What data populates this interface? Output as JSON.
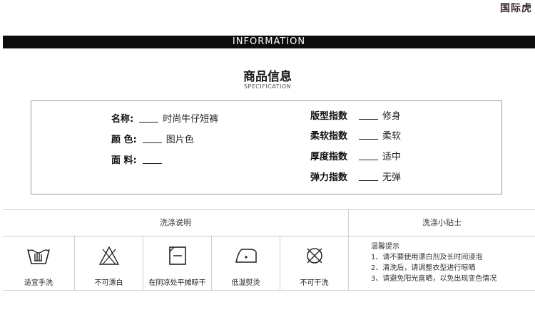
{
  "watermark": "国际虎",
  "banner": "INFORMATION",
  "spec": {
    "title": "商品信息",
    "subtitle": "SPECIFICATION",
    "left": [
      {
        "label": "名称:",
        "value": "时尚牛仔短裤"
      },
      {
        "label": "颜 色:",
        "value": "图片色"
      },
      {
        "label": "面 料:",
        "value": ""
      }
    ],
    "right": [
      {
        "label": "版型指数",
        "value": "修身"
      },
      {
        "label": "柔软指数",
        "value": "柔软"
      },
      {
        "label": "厚度指数",
        "value": "适中"
      },
      {
        "label": "弹力指数",
        "value": "无弹"
      }
    ]
  },
  "care": {
    "wash_header": "洗涤说明",
    "tips_header": "洗涤小贴士",
    "icons": [
      {
        "icon": "hand-wash-icon",
        "caption": "适宜手洗"
      },
      {
        "icon": "no-bleach-icon",
        "caption": "不可漂白"
      },
      {
        "icon": "dry-flat-shade-icon",
        "caption": "在阴凉处平摊晾干"
      },
      {
        "icon": "low-iron-icon",
        "caption": "低温熨烫"
      },
      {
        "icon": "no-dry-clean-icon",
        "caption": "不可干洗"
      }
    ],
    "tips_title": "温馨提示",
    "tips": [
      "1、请不要使用漂白剂及长时间浸泡",
      "2、清洗后，请调整衣型进行晾晒",
      "3、请避免阳光直晒，以免出现变色情况"
    ]
  }
}
